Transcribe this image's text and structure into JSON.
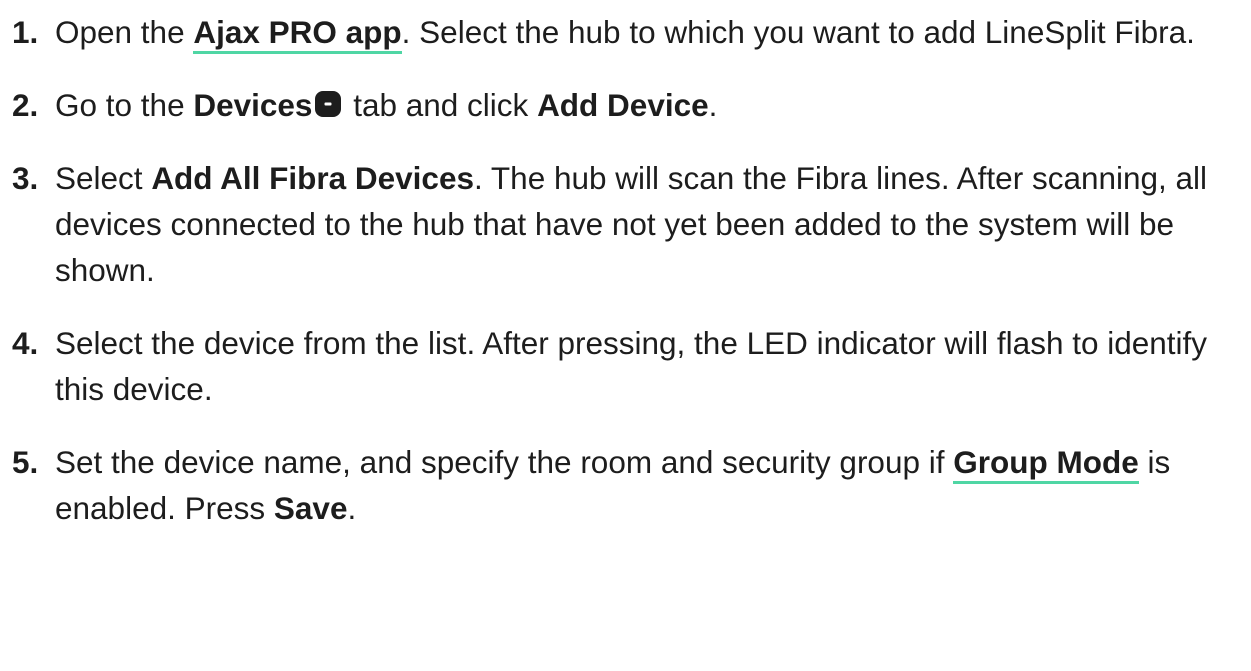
{
  "steps": [
    {
      "num": "1.",
      "t1": "Open the ",
      "link": "Ajax PRO app",
      "t2": ". Select the hub to which you want to add LineSplit Fibra."
    },
    {
      "num": "2.",
      "t1": "Go to the ",
      "b1": "Devices",
      "icon": "devices-tab-icon",
      "t2": " tab and click ",
      "b2": "Add Device",
      "t3": "."
    },
    {
      "num": "3.",
      "t1": "Select ",
      "b1": "Add All Fibra Devices",
      "t2": ". The hub will scan the Fibra lines. After scanning, all devices connected to the hub that have not yet been added to the system will be shown."
    },
    {
      "num": "4.",
      "t1": "Select the device from the list. After pressing, the LED indicator will flash to identify this device."
    },
    {
      "num": "5.",
      "t1": "Set the device name, and specify the room and security group if ",
      "link": "Group Mode",
      "t2": " is enabled. Press ",
      "b1": "Save",
      "t3": "."
    }
  ],
  "colors": {
    "text": "#1d1d1d",
    "link_underline": "#4fd6a4",
    "icon": "#1d1d1d"
  }
}
